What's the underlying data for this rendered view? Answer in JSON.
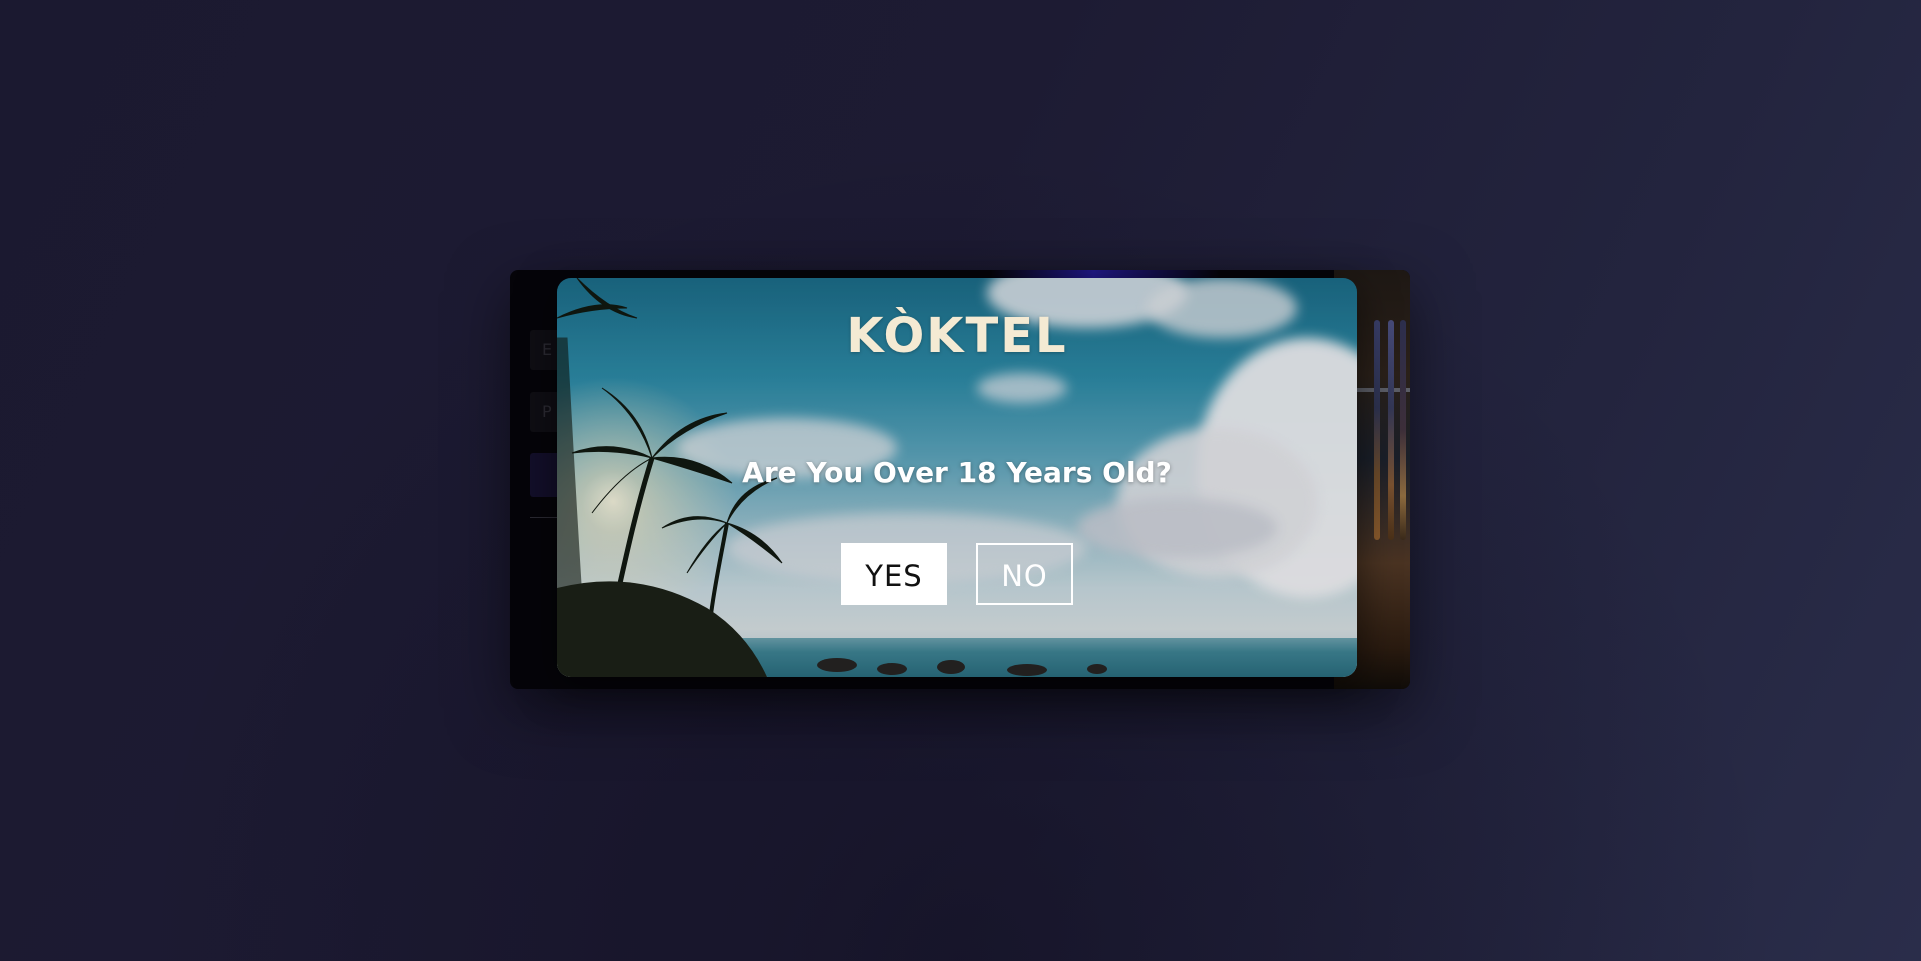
{
  "login_form": {
    "email_placeholder": "E",
    "password_placeholder": "P"
  },
  "age_gate": {
    "brand": "KÒKTEL",
    "question": "Are You Over 18 Years Old?",
    "yes_label": "YES",
    "no_label": "NO"
  },
  "colors": {
    "page_background": "#1d1b33",
    "brand_text": "#f4ead3",
    "yes_button_bg": "#ffffff",
    "no_button_border": "#ffffff"
  }
}
